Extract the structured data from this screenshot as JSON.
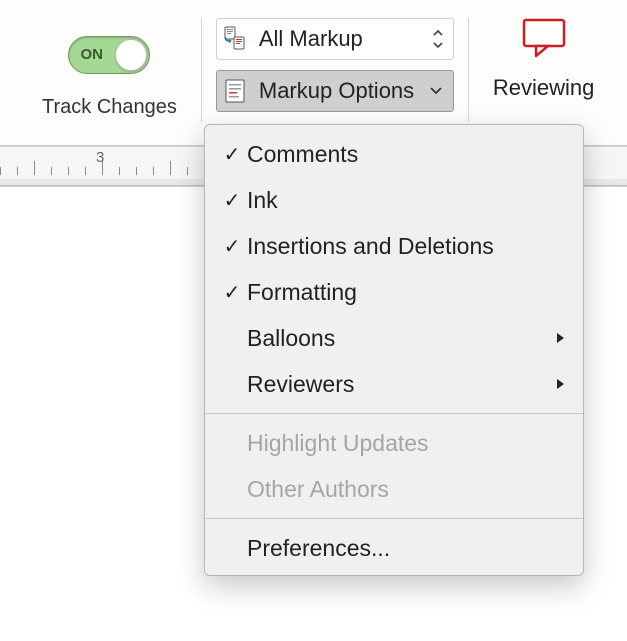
{
  "track_changes": {
    "toggle_state_label": "ON",
    "label": "Track Changes"
  },
  "markup": {
    "display_mode": "All Markup",
    "options_label": "Markup Options"
  },
  "reviewing": {
    "label": "Reviewing"
  },
  "ruler": {
    "visible_number": "3"
  },
  "menu": {
    "items": [
      {
        "label": "Comments",
        "checked": true,
        "submenu": false,
        "enabled": true
      },
      {
        "label": "Ink",
        "checked": true,
        "submenu": false,
        "enabled": true
      },
      {
        "label": "Insertions and Deletions",
        "checked": true,
        "submenu": false,
        "enabled": true
      },
      {
        "label": "Formatting",
        "checked": true,
        "submenu": false,
        "enabled": true
      },
      {
        "label": "Balloons",
        "checked": false,
        "submenu": true,
        "enabled": true
      },
      {
        "label": "Reviewers",
        "checked": false,
        "submenu": true,
        "enabled": true
      }
    ],
    "disabled_items": [
      {
        "label": "Highlight Updates"
      },
      {
        "label": "Other Authors"
      }
    ],
    "preferences_label": "Preferences..."
  }
}
